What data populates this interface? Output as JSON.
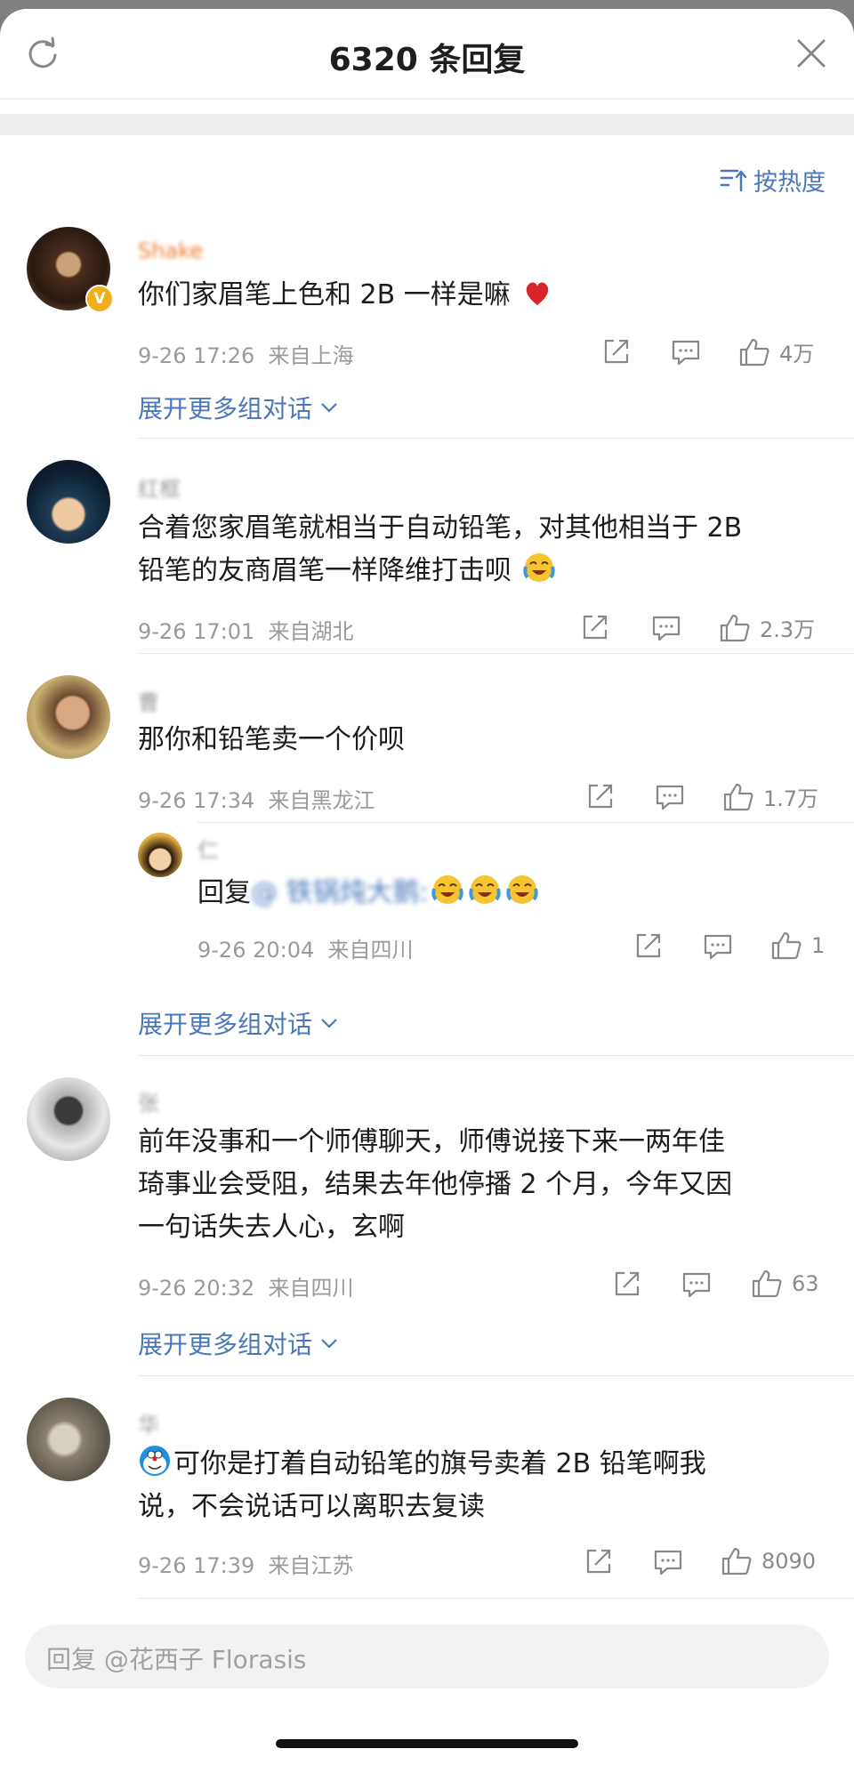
{
  "header": {
    "title": "6320 条回复"
  },
  "sort": {
    "label": "按热度"
  },
  "expand_label": "展开更多组对话",
  "comments": [
    {
      "username": "Shake",
      "text": "你们家眉笔上色和 2B 一样是嘛",
      "time": "9-26 17:26",
      "location": "来自上海",
      "likes": "4万"
    },
    {
      "username": "红框",
      "line1": "合着您家眉笔就相当于自动铅笔，对其他相当于 2B",
      "line2": "铅笔的友商眉笔一样降维打击呗",
      "time": "9-26 17:01",
      "location": "来自湖北",
      "likes": "2.3万"
    },
    {
      "username": "曹",
      "text": "那你和铅笔卖一个价呗",
      "time": "9-26 17:34",
      "location": "来自黑龙江",
      "likes": "1.7万",
      "reply": {
        "username": "仁",
        "prefix": "回复",
        "mention": "@ 铁锅炖大鹅:",
        "time": "9-26 20:04",
        "location": "来自四川",
        "likes": "1"
      }
    },
    {
      "username": "张",
      "line1": "前年没事和一个师傅聊天，师傅说接下来一两年佳",
      "line2": "琦事业会受阻，结果去年他停播 2 个月，今年又因",
      "line3": "一句话失去人心，玄啊",
      "time": "9-26 20:32",
      "location": "来自四川",
      "likes": "63"
    },
    {
      "username": "华",
      "line1": "可你是打着自动铅笔的旗号卖着 2B 铅笔啊我",
      "line2": "说，不会说话可以离职去复读",
      "time": "9-26 17:39",
      "location": "来自江苏",
      "likes": "8090"
    }
  ],
  "reply_bar": {
    "placeholder": "回复 @花西子 Florasis"
  },
  "colors": {
    "link": "#4a78b8",
    "meta": "#9a9a9a",
    "badge": "#f2b018"
  }
}
